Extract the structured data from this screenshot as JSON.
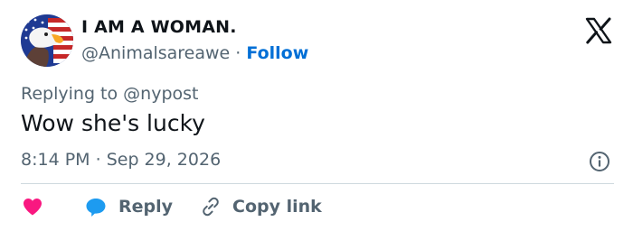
{
  "tweet": {
    "display_name": "I AM A WOMAN.",
    "handle": "@Animalsareawe",
    "separator": "·",
    "follow_label": "Follow",
    "replying_to_label": "Replying to",
    "replying_to_handle": "@nypost",
    "text": "Wow she's lucky",
    "time": "8:14 PM",
    "date_separator": "·",
    "date": "Sep 29, 2026"
  },
  "actions": {
    "like_label": "",
    "reply_label": "Reply",
    "copy_link_label": "Copy link"
  },
  "icons": {
    "avatar": "bald-eagle-flag-avatar",
    "logo": "x-logo-icon",
    "info": "info-icon",
    "like": "heart-icon",
    "reply": "speech-bubble-icon",
    "copy_link": "link-icon"
  },
  "colors": {
    "follow": "#006fd6",
    "heart": "#f91880",
    "reply_bubble": "#1d9bf0",
    "secondary_text": "#536471",
    "divider": "#cfd9de"
  }
}
